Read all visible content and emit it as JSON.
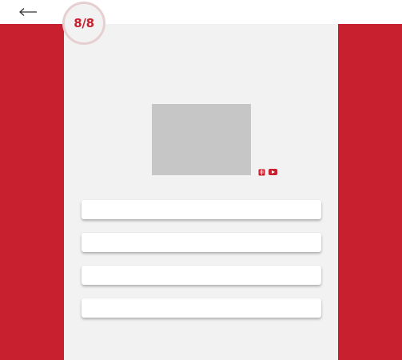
{
  "quiz": {
    "progress": "8/8",
    "current_question": 8,
    "total_questions": 8,
    "options": [
      "",
      "",
      "",
      ""
    ]
  },
  "icons": {
    "back": "arrow-left-icon",
    "book": "book-icon",
    "video": "video-play-icon"
  },
  "colors": {
    "accent": "#c8202f",
    "panel_background": "#f2f2f2",
    "image_placeholder": "#c6c6c6",
    "badge_ring": "#e6cfd1"
  }
}
